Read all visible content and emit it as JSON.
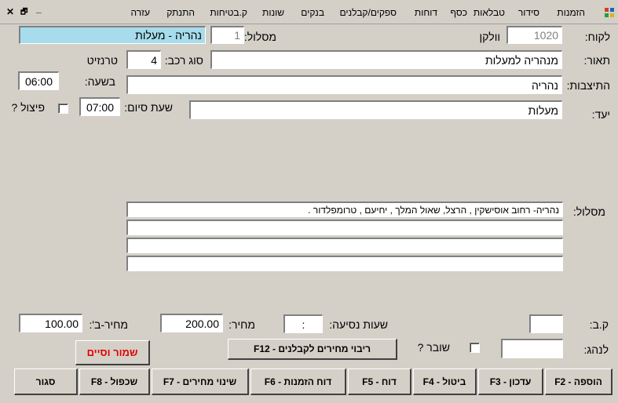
{
  "menu": {
    "items": [
      "הזמנות",
      "סידור",
      "טבלאות",
      "כסף",
      "דוחות",
      "ספקים/קבלנים",
      "בנקים",
      "שונות",
      "ק.בטיחות",
      "התנתק",
      "עזרה"
    ],
    "app_icon": "app-grid-icon",
    "close_glyph": "✕",
    "restore_glyph": "🗗",
    "minimize_glyph": "_"
  },
  "form": {
    "customer_label": "לקוח:",
    "customer_code": "1020",
    "customer_name": "וולקן",
    "route_num_label": "מסלול:",
    "route_num": "1",
    "route_name": "נהריה - מעלות",
    "description_label": "תאור:",
    "description": "מנהריה למעלות",
    "vehicle_type_label": "סוג רכב:",
    "vehicle_type": "4",
    "vehicle_type_name": "טרנזיט",
    "gathering_label": "התיצבות:",
    "gathering": "נהריה",
    "at_time_label": "בשעה:",
    "at_time": "06:00",
    "destination_label": "יעד:",
    "destination": "מעלות",
    "end_time_label": "שעת סיום:",
    "end_time": "07:00",
    "split_label": "פיצול ?",
    "route_label": "מסלול:",
    "route_lines": [
      "נהריה- רחוב אוסישקין , הרצל, שאול המלך , יחיעם , טרומפלדור .",
      "",
      "",
      ""
    ],
    "kb_label": "ק.ב:",
    "kb_value": "",
    "travel_hours_label": "שעות נסיעה:",
    "travel_hours": ":",
    "price_label": "מחיר:",
    "price": "200.00",
    "price_b_label": "מחיר-ב':",
    "price_b": "100.00",
    "driver_label": "לנהג:",
    "driver_value": "",
    "broken_label": "שובר ?"
  },
  "buttons": {
    "save_finish": "שמור וסיים",
    "contractor_prices": "ריבוי מחירים לקבלנים - F12",
    "add": "הוספה - F2",
    "update": "עדכון - F3",
    "cancel": "ביטול - F4",
    "report": "דוח - F5",
    "orders_report": "דוח הזמנות - F6",
    "price_change": "שינוי מחירים - F7",
    "duplicate": "שכפול - F8",
    "close": "סגור"
  },
  "colors": {
    "background": "#d4d0c8",
    "route_name_bg": "#a6dcec",
    "save_text": "#e00000"
  }
}
